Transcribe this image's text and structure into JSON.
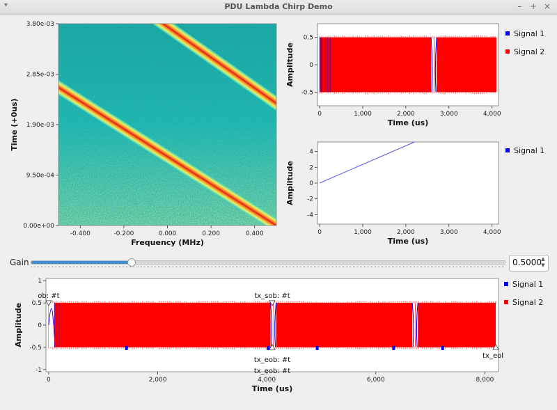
{
  "window": {
    "title": "PDU Lambda Chirp Demo",
    "controls": {
      "minimize": "–",
      "maximize": "+",
      "close": "×"
    },
    "menu_icon": "▾"
  },
  "gain": {
    "label": "Gain",
    "value": "0.5000",
    "fraction": 0.21
  },
  "colors": {
    "signal1": "#0000ff",
    "signal2": "#ff0000"
  },
  "chart_data": [
    {
      "id": "waterfall",
      "type": "heatmap",
      "xlabel": "Frequency (MHz)",
      "ylabel": "Time (+0us)",
      "xlim": [
        -0.5,
        0.5
      ],
      "ylim": [
        0,
        0.0038
      ],
      "x_ticks": [
        "-0.400",
        "-0.200",
        "0.000",
        "0.200",
        "0.400"
      ],
      "y_ticks": [
        "0.00e+00",
        "9.50e-04",
        "1.90e-03",
        "2.85e-03",
        "3.80e-03"
      ],
      "description_lines": [
        {
          "x": [
            -0.5,
            0.5
          ],
          "y": [
            0.0026,
            0.0
          ]
        },
        {
          "x": [
            -0.02,
            0.5
          ],
          "y": [
            0.0038,
            0.0023
          ]
        }
      ]
    },
    {
      "id": "time-top",
      "type": "line",
      "xlabel": "Time (us)",
      "ylabel": "Amplitude",
      "xlim": [
        -50,
        4150
      ],
      "ylim": [
        -0.75,
        0.75
      ],
      "x_ticks": [
        "0",
        "1,000",
        "2,000",
        "3,000",
        "4,000"
      ],
      "y_ticks": [
        "-0.5",
        "0",
        "0.5"
      ],
      "series": [
        {
          "name": "Signal 1"
        },
        {
          "name": "Signal 2"
        }
      ]
    },
    {
      "id": "time-mid",
      "type": "line",
      "xlabel": "Time (us)",
      "ylabel": "Amplitude",
      "xlim": [
        -50,
        4150
      ],
      "ylim": [
        -5.2,
        5.2
      ],
      "x_ticks": [
        "0",
        "1,000",
        "2,000",
        "3,000",
        "4,000"
      ],
      "y_ticks": [
        "-4",
        "-2",
        "0",
        "2",
        "4"
      ],
      "series": [
        {
          "name": "Signal 1",
          "x": [
            0,
            2200
          ],
          "y": [
            0,
            5.2
          ]
        }
      ]
    },
    {
      "id": "time-bottom",
      "type": "line",
      "xlabel": "Time (us)",
      "ylabel": "Amplitude",
      "xlim": [
        -50,
        8250
      ],
      "ylim": [
        -1.05,
        1.05
      ],
      "x_ticks": [
        "0",
        "2,000",
        "4,000",
        "6,000",
        "8,000"
      ],
      "y_ticks": [
        "-1",
        "-0.5",
        "0",
        "0.5",
        "1"
      ],
      "series": [
        {
          "name": "Signal 1"
        },
        {
          "name": "Signal 2"
        }
      ],
      "annotations": [
        {
          "text": "tx_sob: #t",
          "display": "ob: #t",
          "x": 0
        },
        {
          "text": "tx_sob: #t",
          "x": 4100
        },
        {
          "text": "tx_eob: #t",
          "x": 4100
        },
        {
          "text": "tx_eob: #t",
          "x": 4100
        },
        {
          "text": "tx_eob: #t",
          "display": "tx_eol",
          "x": 8200
        }
      ]
    }
  ]
}
